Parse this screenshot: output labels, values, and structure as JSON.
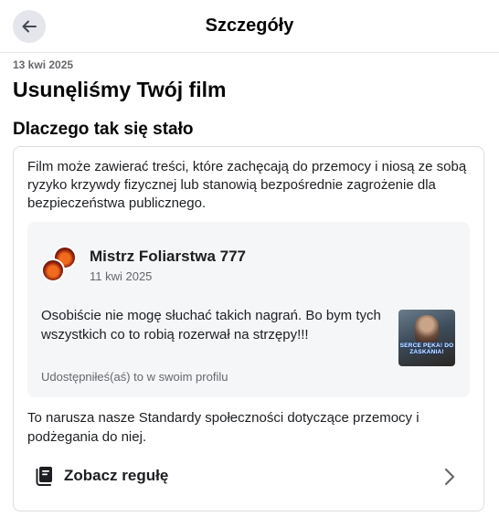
{
  "header": {
    "title": "Szczegóły",
    "back_icon": "arrow-left-icon"
  },
  "notice": {
    "date": "13 kwi 2025",
    "title": "Usunęliśmy Twój film",
    "section_title": "Dlaczego tak się stało"
  },
  "card": {
    "reason": "Film może zawierać treści, które zachęcają do przemocy i niosą ze sobą ryzyko krzywdy fizycznej lub stanowią bezpośrednie zagrożenie dla bezpieczeństwa publicznego.",
    "post": {
      "author": "Mistrz Foliarstwa 777",
      "date": "11 kwi 2025",
      "text": "Osobiście nie mogę słuchać takich nagrań. Bo bym tych wszystkich co to robią rozerwał na strzępy!!!",
      "thumbnail_text": "SERCE PĘKA! DO ZASKANIA!",
      "shared_note": "Udostępniłeś(aś) to w swoim profilu"
    },
    "violation": "To narusza nasze Standardy społeczności dotyczące przemocy i podżegania do niej.",
    "rule_link": {
      "label": "Zobacz regułę",
      "icon": "rulebook-icon",
      "chevron_icon": "chevron-right-icon"
    }
  },
  "colors": {
    "background": "#ffffff",
    "secondary_text": "#65676b",
    "post_background": "#f4f6f8",
    "border": "#dadde1"
  }
}
